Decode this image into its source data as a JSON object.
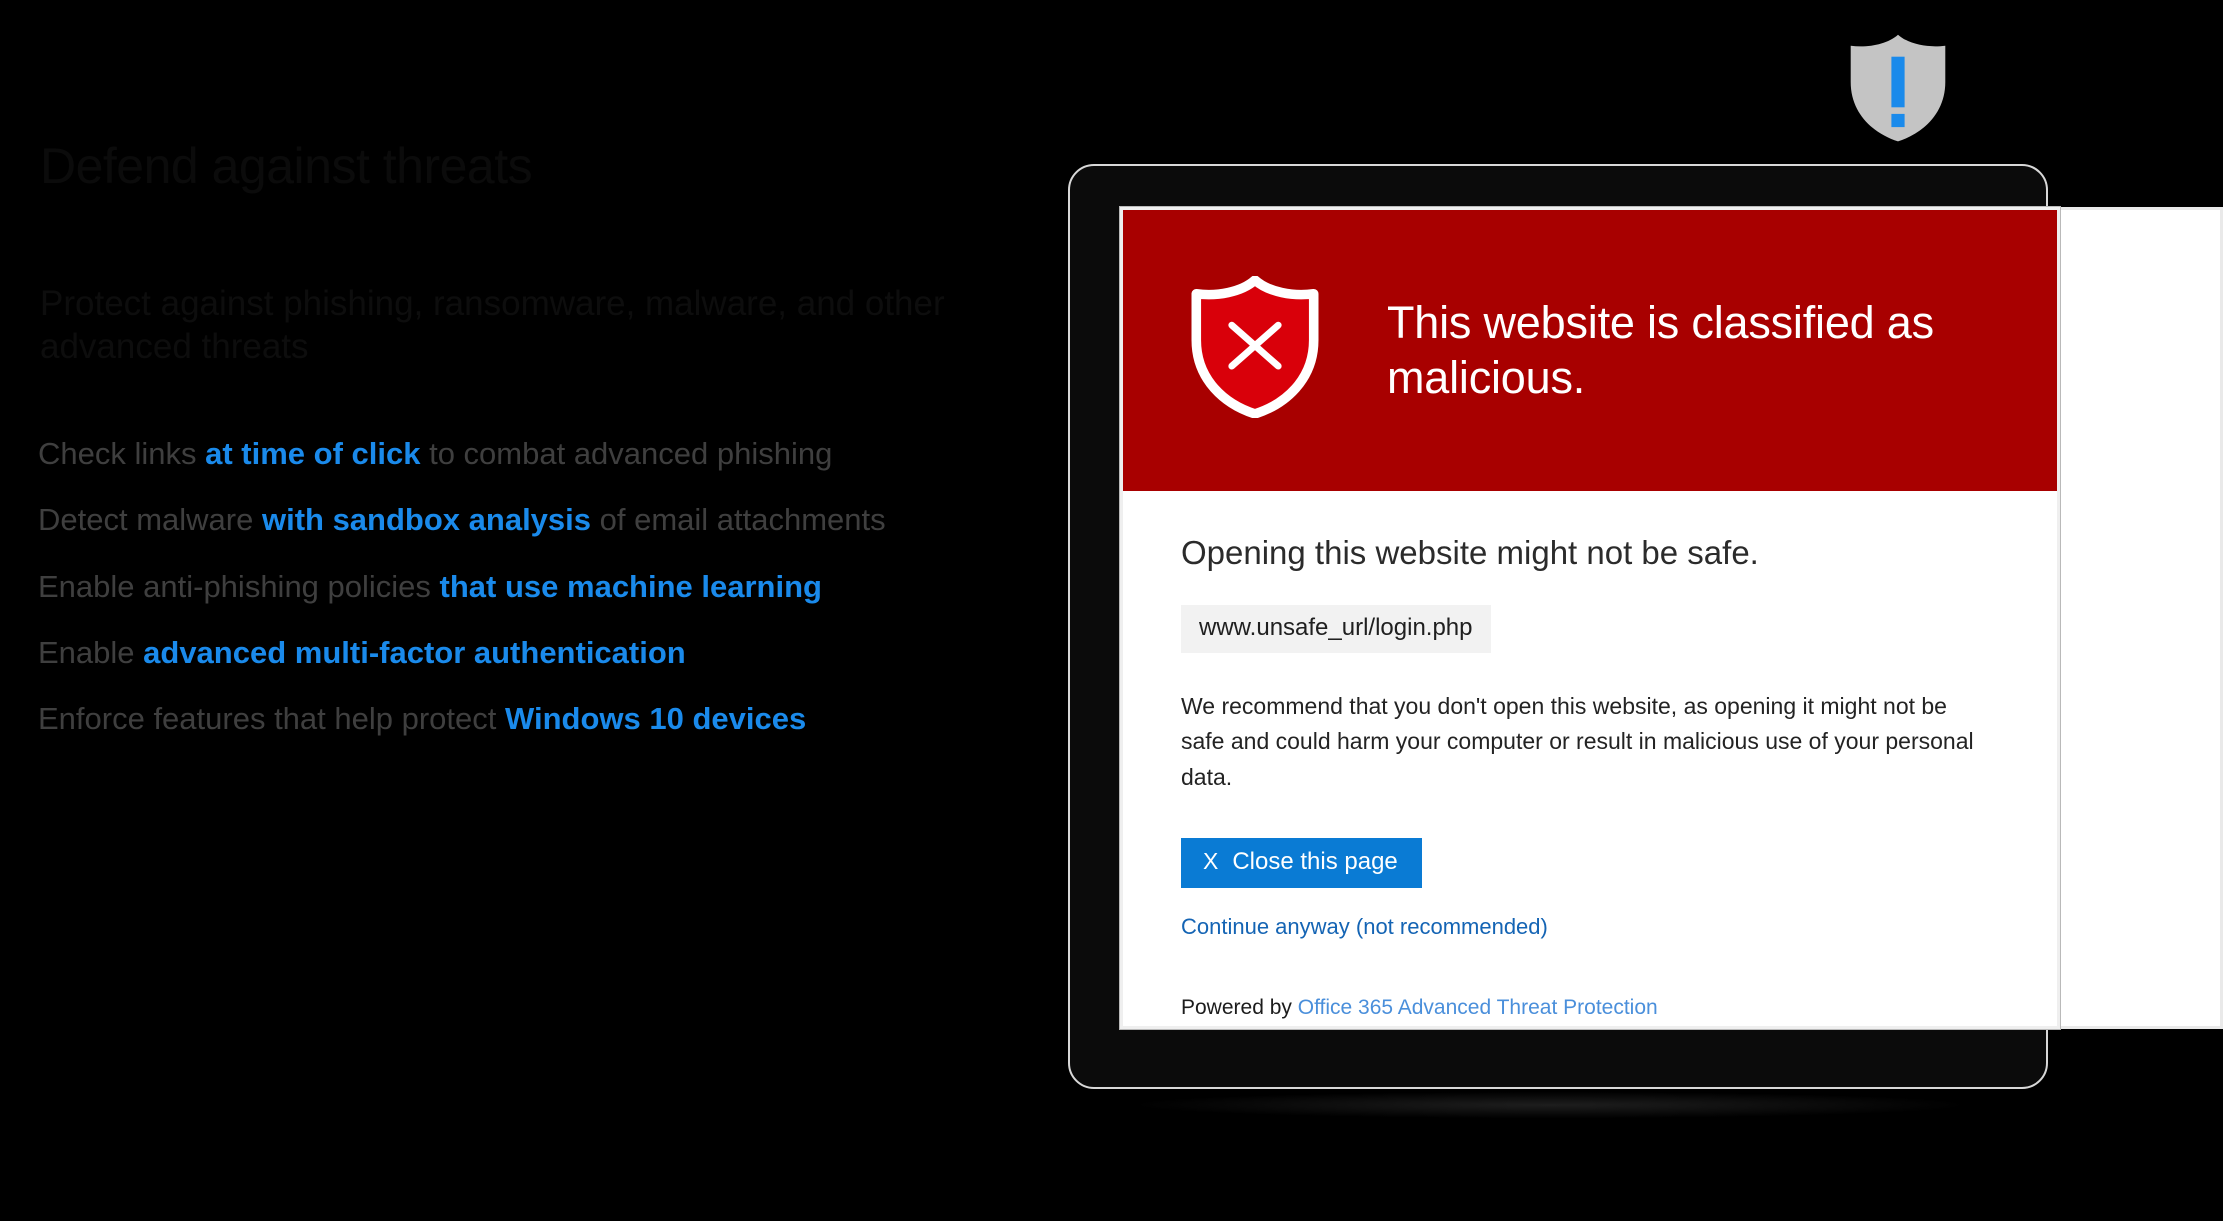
{
  "slide": {
    "title": "Defend against threats",
    "subtitle": "Protect against phishing, ransomware, malware, and other advanced threats",
    "bullets": [
      {
        "pre": "Check links ",
        "highlight": "at time of click",
        "post": " to combat advanced phishing"
      },
      {
        "pre": "Detect malware ",
        "highlight": "with sandbox analysis",
        "post": " of email attachments"
      },
      {
        "pre": "Enable anti-phishing policies ",
        "highlight": "that use machine learning",
        "post": ""
      },
      {
        "pre": "Enable ",
        "highlight": "advanced multi-factor authentication",
        "post": ""
      },
      {
        "pre": "Enforce features that help protect ",
        "highlight": "Windows 10 devices",
        "post": ""
      }
    ]
  },
  "colors": {
    "accent_blue": "#1a8aeb",
    "warning_red": "#a80000",
    "button_blue": "#0a7bd4",
    "link_blue": "#1464b4",
    "shield_gray": "#c4c4c4",
    "shield_mark_blue": "#1a8aeb"
  },
  "warning_dialog": {
    "icon": "shield-x-icon",
    "header_title": "This website is classified as malicious.",
    "lede": "Opening this website might not be safe.",
    "url": "www.unsafe_url/login.php",
    "paragraph": "We recommend that you don't open this website, as opening it might not be safe and could harm your computer or result in malicious use of your personal data.",
    "close_button": {
      "glyph": "X",
      "label": "Close this page"
    },
    "continue_link": "Continue anyway (not recommended)",
    "powered_by_prefix": "Powered by ",
    "powered_by_link": "Office 365 Advanced Threat Protection"
  },
  "badge": {
    "icon": "shield-exclamation-icon",
    "mark": "!"
  }
}
